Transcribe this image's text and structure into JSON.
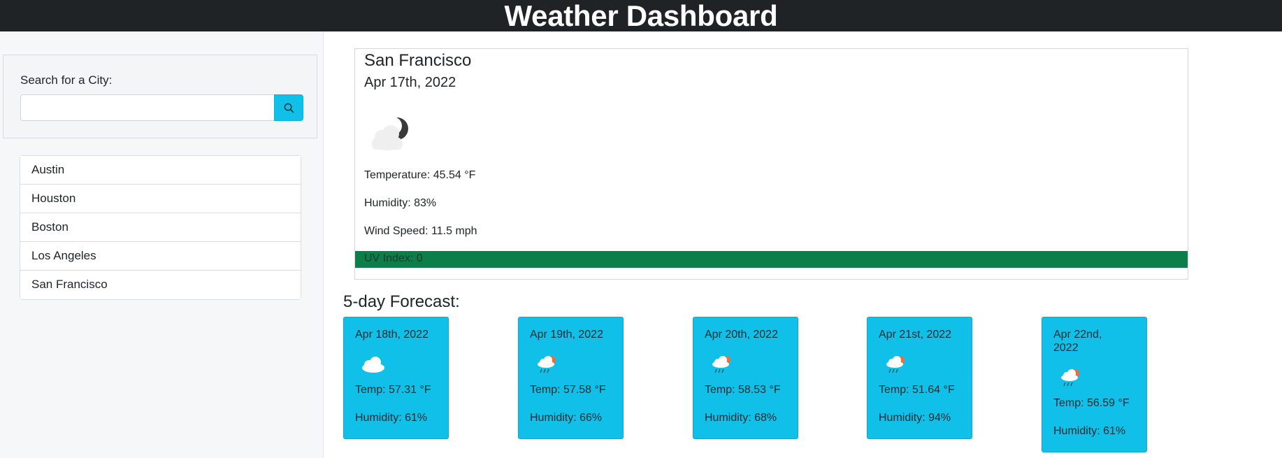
{
  "header": {
    "title": "Weather Dashboard"
  },
  "search": {
    "label": "Search for a City:",
    "value": "",
    "placeholder": "",
    "button_icon": "search-icon"
  },
  "history": [
    "Austin",
    "Houston",
    "Boston",
    "Los Angeles",
    "San Francisco"
  ],
  "current": {
    "city": "San Francisco",
    "date": "Apr 17th, 2022",
    "icon": "night-cloudy-icon",
    "temperature": "Temperature: 45.54 °F",
    "humidity": "Humidity: 83%",
    "wind": "Wind Speed: 11.5 mph",
    "uv": "UV Index: 0",
    "uv_color": "#0b7e4a"
  },
  "forecast": {
    "title": "5-day Forecast:",
    "accent": "#10c0e8",
    "days": [
      {
        "date": "Apr 18th, 2022",
        "icon": "cloud-icon",
        "temp": "Temp: 57.31 °F",
        "humidity": "Humidity: 61%"
      },
      {
        "date": "Apr 19th, 2022",
        "icon": "sun-rain-icon",
        "temp": "Temp: 57.58 °F",
        "humidity": "Humidity: 66%"
      },
      {
        "date": "Apr 20th, 2022",
        "icon": "sun-rain-icon",
        "temp": "Temp: 58.53 °F",
        "humidity": "Humidity: 68%"
      },
      {
        "date": "Apr 21st, 2022",
        "icon": "sun-rain-icon",
        "temp": "Temp: 51.64 °F",
        "humidity": "Humidity: 94%"
      },
      {
        "date": "Apr 22nd, 2022",
        "icon": "sun-rain-icon",
        "temp": "Temp: 56.59 °F",
        "humidity": "Humidity: 61%"
      }
    ]
  }
}
